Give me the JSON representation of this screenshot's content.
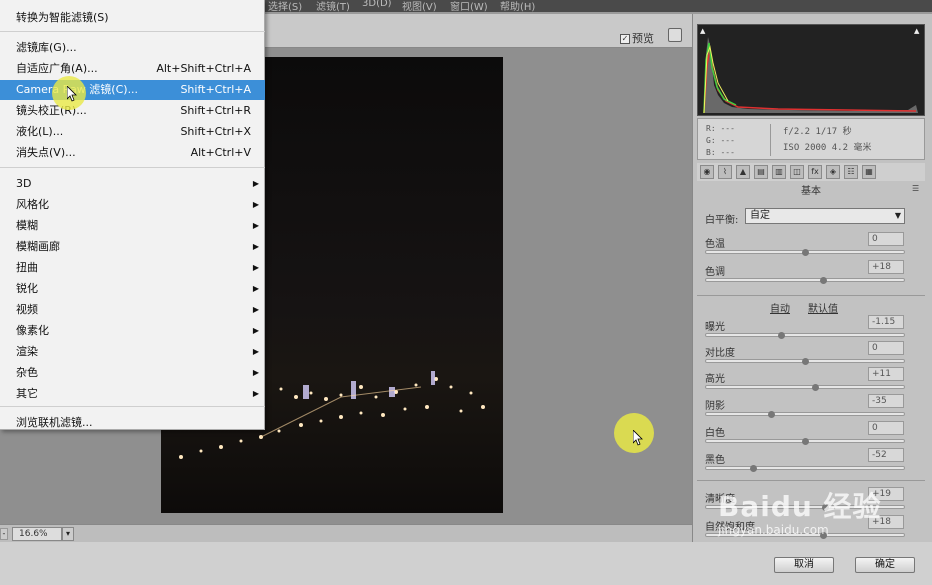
{
  "menubar": {
    "items": [
      "选择(S)",
      "滤镜(T)",
      "3D(D)",
      "视图(V)",
      "窗口(W)",
      "帮助(H)"
    ]
  },
  "filter_menu": {
    "items": [
      {
        "label": "转换为智能滤镜(S)",
        "shortcut": ""
      },
      {
        "label": "滤镜库(G)...",
        "shortcut": ""
      },
      {
        "label": "自适应广角(A)...",
        "shortcut": "Alt+Shift+Ctrl+A"
      },
      {
        "label": "Camera Raw 滤镜(C)...",
        "shortcut": "Shift+Ctrl+A"
      },
      {
        "label": "镜头校正(R)...",
        "shortcut": "Shift+Ctrl+R"
      },
      {
        "label": "液化(L)...",
        "shortcut": "Shift+Ctrl+X"
      },
      {
        "label": "消失点(V)...",
        "shortcut": "Alt+Ctrl+V"
      },
      {
        "label": "3D"
      },
      {
        "label": "风格化"
      },
      {
        "label": "模糊"
      },
      {
        "label": "模糊画廊"
      },
      {
        "label": "扭曲"
      },
      {
        "label": "锐化"
      },
      {
        "label": "视频"
      },
      {
        "label": "像素化"
      },
      {
        "label": "渲染"
      },
      {
        "label": "杂色"
      },
      {
        "label": "其它"
      },
      {
        "label": "浏览联机滤镜..."
      }
    ]
  },
  "toolbar": {
    "preview_label": "预览",
    "preview_checked": "✓"
  },
  "status": {
    "zoom": "16.6%"
  },
  "info": {
    "r": "R:  ---",
    "g": "G:  ---",
    "b": "B:  ---",
    "aperture_shutter": "f/2.2   1/17 秒",
    "iso_focal": "ISO 2000   4.2 毫米"
  },
  "panel": {
    "section_title": "基本",
    "white_balance_label": "白平衡:",
    "white_balance_value": "自定",
    "auto_label": "自动",
    "default_label": "默认值",
    "sliders": [
      {
        "label": "色温",
        "value": "0",
        "pos": 0.5
      },
      {
        "label": "色调",
        "value": "+18",
        "pos": 0.59
      },
      {
        "label": "曝光",
        "value": "-1.15",
        "pos": 0.38
      },
      {
        "label": "对比度",
        "value": "0",
        "pos": 0.5
      },
      {
        "label": "高光",
        "value": "+11",
        "pos": 0.55
      },
      {
        "label": "阴影",
        "value": "-35",
        "pos": 0.33
      },
      {
        "label": "白色",
        "value": "0",
        "pos": 0.5
      },
      {
        "label": "黑色",
        "value": "-52",
        "pos": 0.24
      },
      {
        "label": "清晰度",
        "value": "+19",
        "pos": 0.6
      },
      {
        "label": "自然饱和度",
        "value": "+18",
        "pos": 0.59
      }
    ]
  },
  "buttons": {
    "cancel": "取消",
    "ok": "确定"
  },
  "watermark": {
    "brand": "Baidu 经验",
    "url": "jingyan.baidu.com"
  }
}
